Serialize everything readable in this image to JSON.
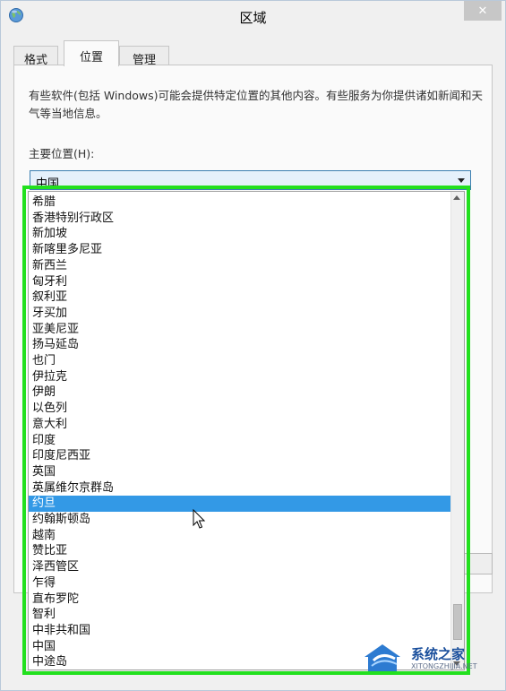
{
  "window": {
    "title": "区域",
    "close_symbol": "✕",
    "icon": "globe-icon"
  },
  "tabs": [
    {
      "label": "格式",
      "active": false
    },
    {
      "label": "位置",
      "active": true
    },
    {
      "label": "管理",
      "active": false
    }
  ],
  "location_panel": {
    "description": "有些软件(包括 Windows)可能会提供特定位置的其他内容。有些服务为你提供诸如新闻和天气等当地信息。",
    "primary_label": "主要位置(H):",
    "selected_value": "中国"
  },
  "dropdown": {
    "items": [
      "希腊",
      "香港特别行政区",
      "新加坡",
      "新喀里多尼亚",
      "新西兰",
      "匈牙利",
      "叙利亚",
      "牙买加",
      "亚美尼亚",
      "扬马延岛",
      "也门",
      "伊拉克",
      "伊朗",
      "以色列",
      "意大利",
      "印度",
      "印度尼西亚",
      "英国",
      "英属维尔京群岛",
      "约旦",
      "约翰斯顿岛",
      "越南",
      "赞比亚",
      "泽西管区",
      "乍得",
      "直布罗陀",
      "智利",
      "中非共和国",
      "中国",
      "中途岛"
    ],
    "highlighted_item": "约旦"
  },
  "watermark": {
    "brand": "系统之家",
    "url": "XITONGZHIJIA.NET"
  },
  "colors": {
    "selection": "#3399e6",
    "highlight_frame": "#22e01e",
    "combo_border": "#3c7fb1"
  }
}
